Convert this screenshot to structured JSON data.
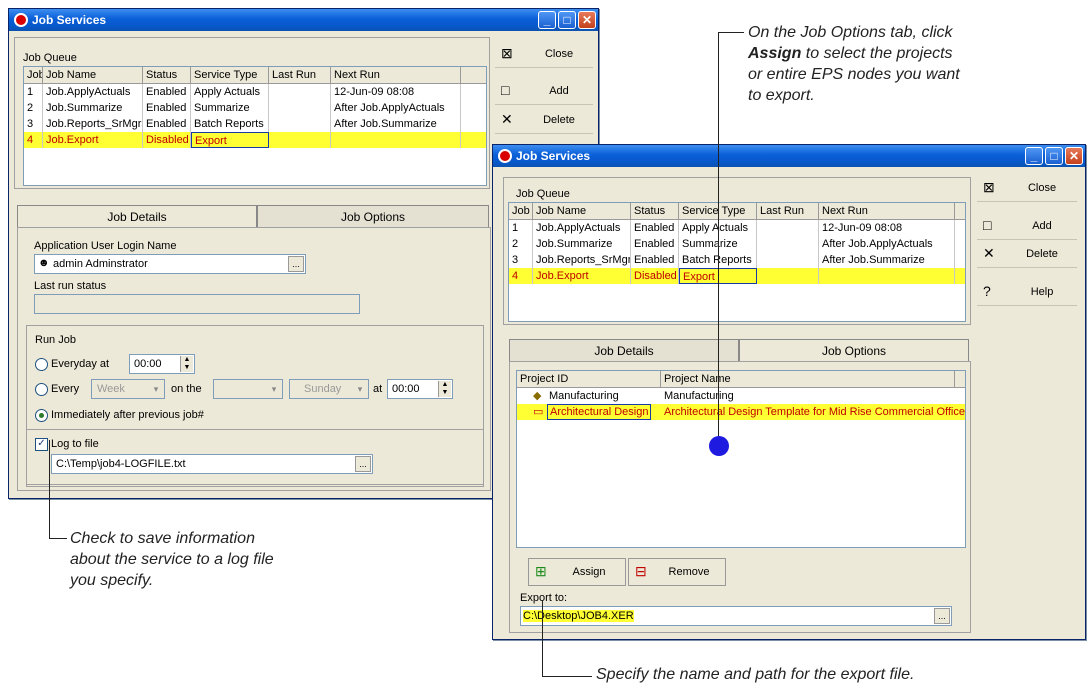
{
  "win1": {
    "title": "Job Services",
    "queue_label": "Job Queue",
    "headers": [
      "Job",
      "Job Name",
      "Status",
      "Service Type",
      "Last Run",
      "Next Run"
    ],
    "rows": [
      {
        "job": "1",
        "name": "Job.ApplyActuals",
        "status": "Enabled",
        "type": "Apply Actuals",
        "last": "",
        "next": "12-Jun-09 08:08"
      },
      {
        "job": "2",
        "name": "Job.Summarize",
        "status": "Enabled",
        "type": "Summarize",
        "last": "",
        "next": "After Job.ApplyActuals"
      },
      {
        "job": "3",
        "name": "Job.Reports_SrMgrs",
        "status": "Enabled",
        "type": "Batch Reports",
        "last": "",
        "next": "After Job.Summarize"
      },
      {
        "job": "4",
        "name": "Job.Export",
        "status": "Disabled",
        "type": "Export",
        "last": "",
        "next": ""
      }
    ],
    "buttons": {
      "close": "Close",
      "add": "Add",
      "delete": "Delete"
    },
    "tabs": {
      "details": "Job Details",
      "options": "Job Options"
    },
    "app_user_label": "Application User Login Name",
    "app_user_value": "admin Adminstrator",
    "last_run_label": "Last run status",
    "run_job_label": "Run Job",
    "everyday_label": "Everyday at",
    "everyday_time": "00:00",
    "every_label": "Every",
    "every_unit": "Week",
    "on_the_label": "on the",
    "on_the_value": "",
    "day_value": "Sunday",
    "at_label": "at",
    "at_time": "00:00",
    "immediately_label": "Immediately after previous job#",
    "log_label": "Log to file",
    "log_path": "C:\\Temp\\job4-LOGFILE.txt"
  },
  "win2": {
    "title": "Job Services",
    "queue_label": "Job Queue",
    "headers": [
      "Job",
      "Job Name",
      "Status",
      "Service Type",
      "Last Run",
      "Next Run"
    ],
    "rows": [
      {
        "job": "1",
        "name": "Job.ApplyActuals",
        "status": "Enabled",
        "type": "Apply Actuals",
        "last": "",
        "next": "12-Jun-09 08:08"
      },
      {
        "job": "2",
        "name": "Job.Summarize",
        "status": "Enabled",
        "type": "Summarize",
        "last": "",
        "next": "After Job.ApplyActuals"
      },
      {
        "job": "3",
        "name": "Job.Reports_SrMgrs",
        "status": "Enabled",
        "type": "Batch Reports",
        "last": "",
        "next": "After Job.Summarize"
      },
      {
        "job": "4",
        "name": "Job.Export",
        "status": "Disabled",
        "type": "Export",
        "last": "",
        "next": ""
      }
    ],
    "buttons": {
      "close": "Close",
      "add": "Add",
      "delete": "Delete",
      "help": "Help"
    },
    "tabs": {
      "details": "Job Details",
      "options": "Job Options"
    },
    "project_headers": [
      "Project ID",
      "Project Name"
    ],
    "projects": [
      {
        "id": "Manufacturing",
        "name": "Manufacturing"
      },
      {
        "id": "Architectural Design",
        "name": "Architectural Design Template for Mid Rise Commercial Office"
      }
    ],
    "assign_label": "Assign",
    "remove_label": "Remove",
    "export_label": "Export to:",
    "export_path": "C:\\Desktop\\JOB4.XER"
  },
  "callouts": {
    "top_right_1": "On the Job Options tab, click",
    "top_right_bold": "Assign",
    "top_right_2": " to select the projects",
    "top_right_3": "or entire EPS nodes you want",
    "top_right_4": "to export.",
    "left_1": "Check to save information",
    "left_2": "about the service to a log file",
    "left_3": "you specify.",
    "bottom": "Specify the name and path for the export file."
  },
  "colors": {
    "highlight": "#ffff33",
    "title_bar": "#0a5fd8"
  }
}
